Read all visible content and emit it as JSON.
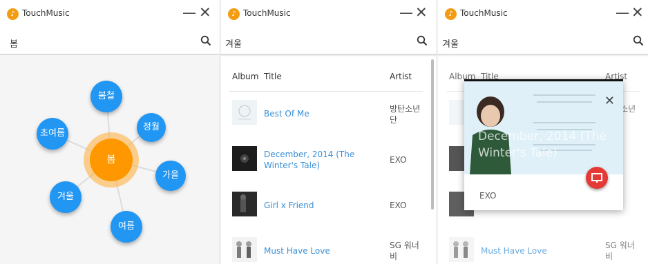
{
  "app": {
    "title": "TouchMusic"
  },
  "windows": [
    {
      "search_value": "봄"
    },
    {
      "search_value": "겨울"
    },
    {
      "search_value": "겨울"
    }
  ],
  "bubbles": {
    "center": "봄",
    "items": [
      "봄철",
      "정월",
      "초여름",
      "가을",
      "겨울",
      "여름"
    ]
  },
  "table": {
    "headers": {
      "album": "Album",
      "title": "Title",
      "artist": "Artist"
    },
    "rows": [
      {
        "title": "Best Of Me",
        "artist": "방탄소년단"
      },
      {
        "title": "December, 2014 (The Winter's Tale)",
        "artist": "EXO"
      },
      {
        "title": "Girl x Friend",
        "artist": "EXO"
      },
      {
        "title": "Must Have Love",
        "artist": "SG 워너비"
      }
    ]
  },
  "popup": {
    "title": "December, 2014 (The Winter's Tale)",
    "artist": "EXO"
  },
  "colors": {
    "accent_orange": "#ff9800",
    "bubble_blue": "#2196f3",
    "link_blue": "#3a8fd6",
    "fab_red": "#e53935"
  }
}
